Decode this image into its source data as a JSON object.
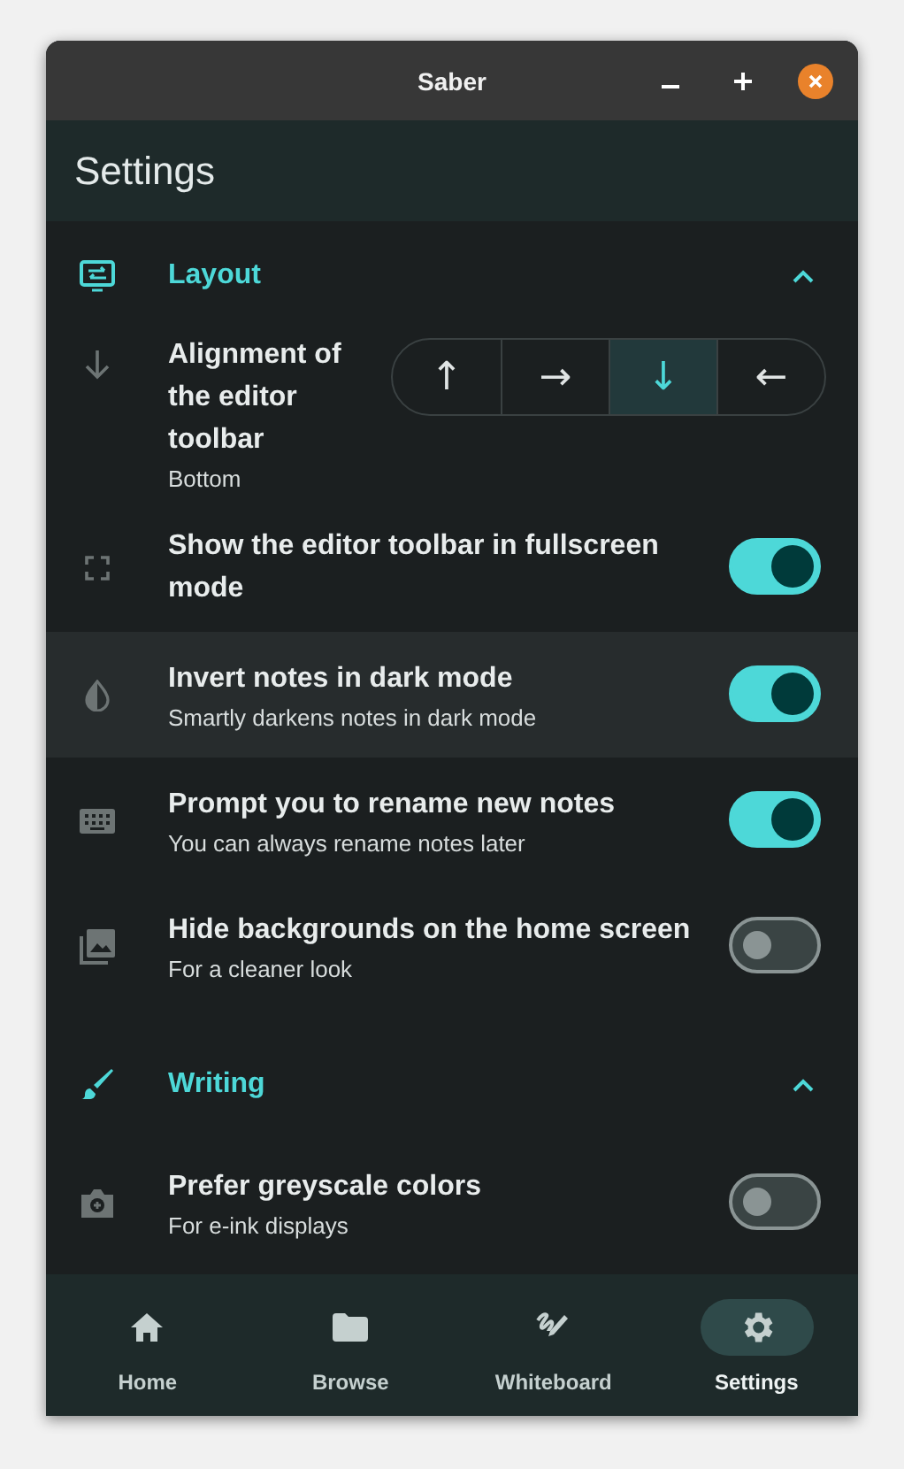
{
  "window": {
    "title": "Saber"
  },
  "app_bar": {
    "title": "Settings"
  },
  "sections": [
    {
      "title": "Layout",
      "expanded": true,
      "items": [
        {
          "kind": "segmented",
          "title": "Alignment of the editor toolbar",
          "subtitle": "Bottom",
          "highlighted": false,
          "options": [
            {
              "label": "↑",
              "selected": false
            },
            {
              "label": "→",
              "selected": false
            },
            {
              "label": "↓",
              "selected": true
            },
            {
              "label": "←",
              "selected": false
            }
          ]
        },
        {
          "kind": "toggle",
          "title": "Show the editor toolbar in fullscreen mode",
          "on": true,
          "highlighted": false
        },
        {
          "kind": "toggle",
          "title": "Invert notes in dark mode",
          "subtitle": "Smartly darkens notes in dark mode",
          "on": true,
          "highlighted": true
        },
        {
          "kind": "toggle",
          "title": "Prompt you to rename new notes",
          "subtitle": "You can always rename notes later",
          "on": true,
          "highlighted": false
        },
        {
          "kind": "toggle",
          "title": "Hide backgrounds on the home screen",
          "subtitle": "For a cleaner look",
          "on": false,
          "highlighted": false
        }
      ]
    },
    {
      "title": "Writing",
      "expanded": true,
      "items": [
        {
          "kind": "toggle",
          "title": "Prefer greyscale colors",
          "subtitle": "For e-ink displays",
          "on": false,
          "highlighted": false
        }
      ]
    }
  ],
  "nav": [
    {
      "label": "Home",
      "selected": false
    },
    {
      "label": "Browse",
      "selected": false
    },
    {
      "label": "Whiteboard",
      "selected": false
    },
    {
      "label": "Settings",
      "selected": true
    }
  ]
}
